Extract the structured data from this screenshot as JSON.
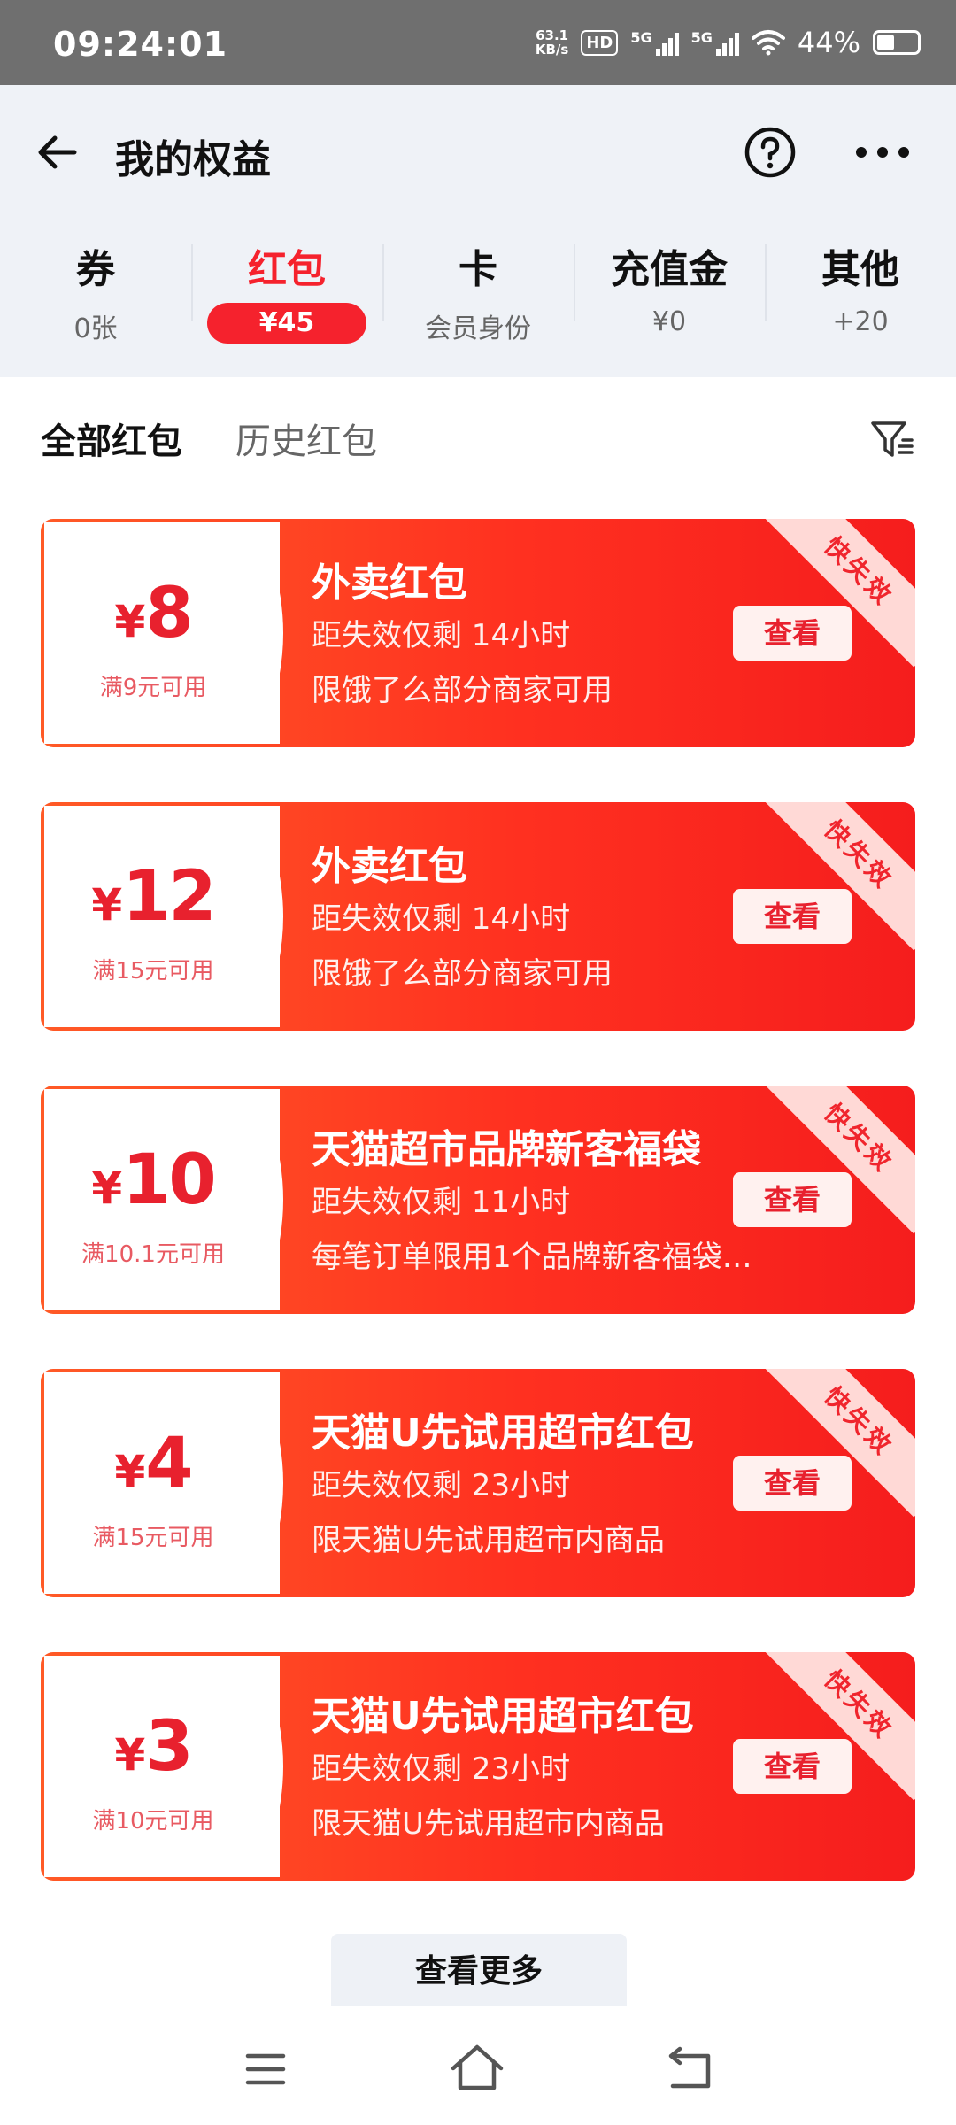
{
  "status_bar": {
    "time": "09:24:01",
    "net_speed_value": "63.1",
    "net_speed_unit": "KB/s",
    "hd_label": "HD",
    "signal1_label": "5G",
    "signal2_label": "5G",
    "battery_percent": "44%",
    "battery_level": 0.44
  },
  "header": {
    "title": "我的权益",
    "back_icon": "arrow-left-icon",
    "help_icon": "question-circle-icon",
    "more_icon": "ellipsis-icon"
  },
  "benefit_tabs": [
    {
      "label": "券",
      "sub": "0张",
      "active": false
    },
    {
      "label": "红包",
      "sub": "¥45",
      "active": true
    },
    {
      "label": "卡",
      "sub": "会员身份",
      "active": false
    },
    {
      "label": "充值金",
      "sub": "¥0",
      "active": false
    },
    {
      "label": "其他",
      "sub": "+20",
      "active": false
    }
  ],
  "sub_tabs": {
    "all": "全部红包",
    "history": "历史红包",
    "filter_icon": "filter-icon"
  },
  "coupons": [
    {
      "currency": "¥",
      "amount": "8",
      "min_spend": "满9元可用",
      "title": "外卖红包",
      "expiry": "距失效仅剩 14小时",
      "desc": "限饿了么部分商家可用",
      "button": "查看",
      "ribbon": "快失效"
    },
    {
      "currency": "¥",
      "amount": "12",
      "min_spend": "满15元可用",
      "title": "外卖红包",
      "expiry": "距失效仅剩 14小时",
      "desc": "限饿了么部分商家可用",
      "button": "查看",
      "ribbon": "快失效"
    },
    {
      "currency": "¥",
      "amount": "10",
      "min_spend": "满10.1元可用",
      "title": "天猫超市品牌新客福袋",
      "expiry": "距失效仅剩 11小时",
      "desc": "每笔订单限用1个品牌新客福袋…",
      "button": "查看",
      "ribbon": "快失效"
    },
    {
      "currency": "¥",
      "amount": "4",
      "min_spend": "满15元可用",
      "title": "天猫U先试用超市红包",
      "expiry": "距失效仅剩 23小时",
      "desc": "限天猫U先试用超市内商品",
      "button": "查看",
      "ribbon": "快失效"
    },
    {
      "currency": "¥",
      "amount": "3",
      "min_spend": "满10元可用",
      "title": "天猫U先试用超市红包",
      "expiry": "距失效仅剩 23小时",
      "desc": "限天猫U先试用超市内商品",
      "button": "查看",
      "ribbon": "快失效"
    }
  ],
  "more_button": "查看更多",
  "navbar": {
    "menu_icon": "menu-icon",
    "home_icon": "home-icon",
    "back_icon": "back-icon"
  },
  "colors": {
    "accent": "#f5222d",
    "coupon_start": "#ff5a26",
    "coupon_end": "#f51d1d",
    "header_bg": "#eff2f7"
  }
}
